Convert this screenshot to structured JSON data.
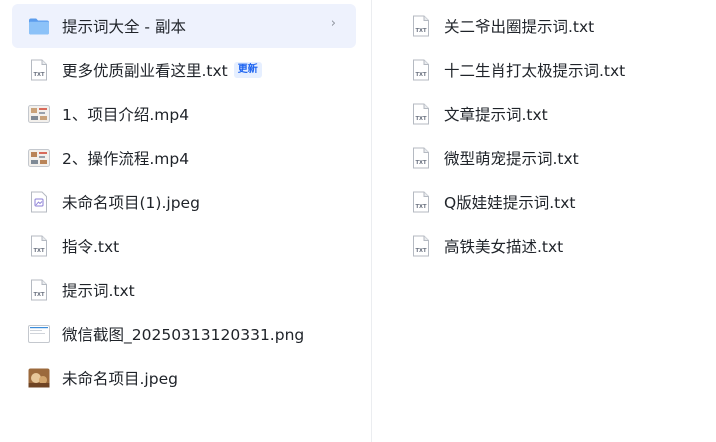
{
  "left_items": [
    {
      "name": "提示词大全 - 副本",
      "icon": "folder-icon",
      "selected": true,
      "has_chevron": true
    },
    {
      "name": "更多优质副业看这里.txt",
      "icon": "txt-file-icon",
      "badge": "更新"
    },
    {
      "name": "1、项目介绍.mp4",
      "icon": "video-thumbnail-icon"
    },
    {
      "name": "2、操作流程.mp4",
      "icon": "video-thumbnail-icon"
    },
    {
      "name": "未命名项目(1).jpeg",
      "icon": "image-file-icon"
    },
    {
      "name": "指令.txt",
      "icon": "txt-file-icon"
    },
    {
      "name": "提示词.txt",
      "icon": "txt-file-icon"
    },
    {
      "name": "微信截图_20250313120331.png",
      "icon": "screenshot-thumbnail-icon"
    },
    {
      "name": "未命名项目.jpeg",
      "icon": "photo-thumbnail-icon"
    }
  ],
  "right_items": [
    {
      "name": "关二爷出圈提示词.txt",
      "icon": "txt-file-icon"
    },
    {
      "name": "十二生肖打太极提示词.txt",
      "icon": "txt-file-icon"
    },
    {
      "name": "文章提示词.txt",
      "icon": "txt-file-icon"
    },
    {
      "name": "微型萌宠提示词.txt",
      "icon": "txt-file-icon"
    },
    {
      "name": "Q版娃娃提示词.txt",
      "icon": "txt-file-icon"
    },
    {
      "name": "高铁美女描述.txt",
      "icon": "txt-file-icon"
    }
  ],
  "icons": {
    "txt_label": "TXT",
    "chevron": "›"
  },
  "colors": {
    "selected_bg": "#eef2fd",
    "folder": "#6aa9f2",
    "badge_text": "#1e64f0",
    "badge_bg": "#e6efff"
  }
}
